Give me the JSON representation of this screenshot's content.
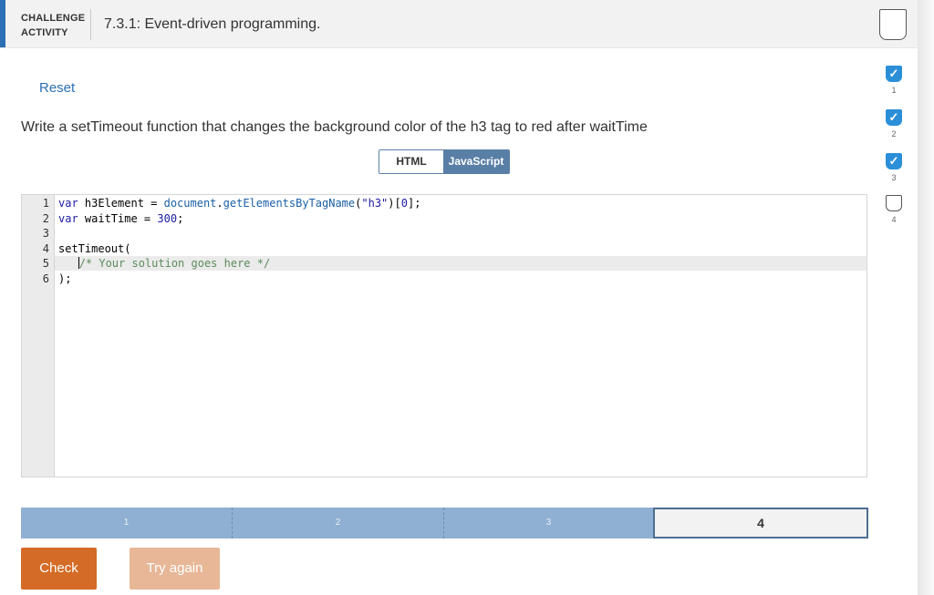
{
  "header": {
    "label_line1": "CHALLENGE",
    "label_line2": "ACTIVITY",
    "title": "7.3.1: Event-driven programming."
  },
  "reset_label": "Reset",
  "prompt": "Write a setTimeout function that changes the background color of the h3 tag to red after waitTime",
  "tabs": {
    "html": "HTML",
    "javascript": "JavaScript",
    "active": "JavaScript"
  },
  "editor": {
    "line_numbers": [
      "1",
      "2",
      "3",
      "4",
      "5",
      "6"
    ],
    "lines": [
      "var h3Element = document.getElementsByTagName(\"h3\")[0];",
      "var waitTime = 300;",
      "",
      "setTimeout(",
      "   /* Your solution goes here */",
      ");"
    ]
  },
  "progress": {
    "levels": [
      "1",
      "2",
      "3",
      "4"
    ],
    "current": "4"
  },
  "buttons": {
    "check": "Check",
    "try_again": "Try again"
  },
  "level_panel": {
    "items": [
      {
        "n": "1",
        "done": true
      },
      {
        "n": "2",
        "done": true
      },
      {
        "n": "3",
        "done": true
      },
      {
        "n": "4",
        "done": false
      }
    ],
    "check_glyph": "✓"
  },
  "colors": {
    "accent": "#2b6fb4",
    "check_button": "#d46b26",
    "try_again_button": "#e8b797",
    "progress_fill": "#8fb0d2",
    "done_badge": "#2b8fd8"
  }
}
